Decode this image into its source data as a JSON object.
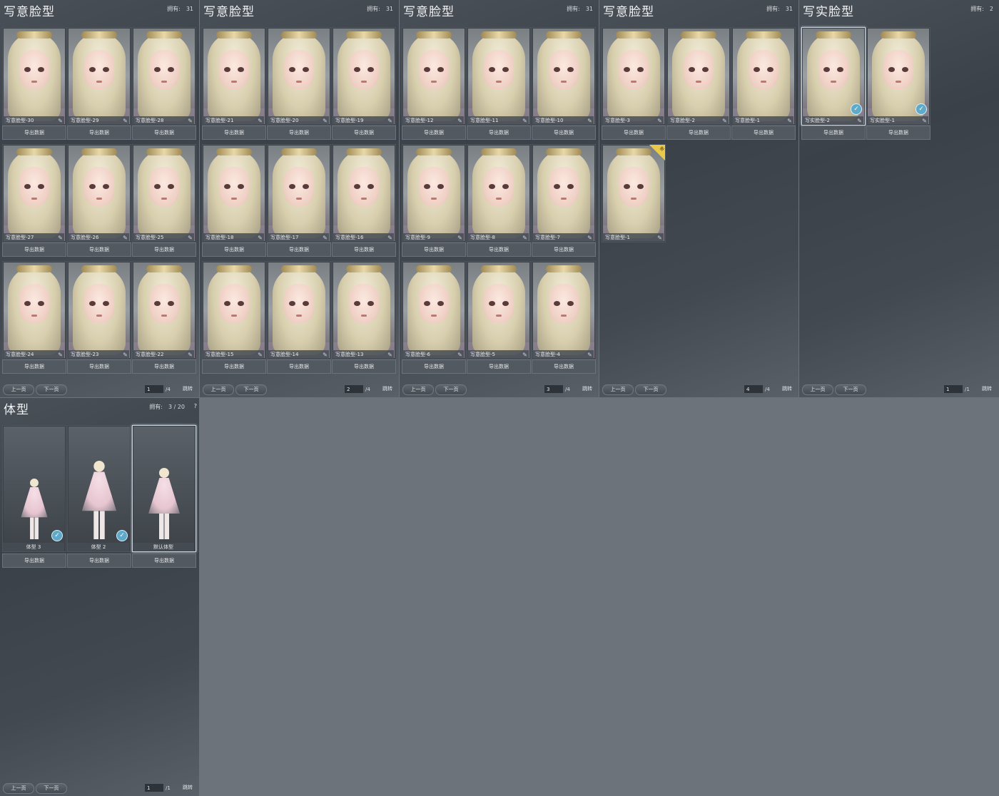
{
  "common": {
    "export_label": "导出数据",
    "prev_label": "上一页",
    "next_label": "下一页",
    "jump_label": "跳转",
    "owned_label": "拥有:"
  },
  "panels": [
    {
      "title": "写意脸型",
      "owned": "31",
      "page": "1",
      "total": "/4",
      "cards": [
        "写意脸型-30",
        "写意脸型-29",
        "写意脸型-28",
        "写意脸型-27",
        "写意脸型-26",
        "写意脸型-25",
        "写意脸型-24",
        "写意脸型-23",
        "写意脸型-22"
      ]
    },
    {
      "title": "写意脸型",
      "owned": "31",
      "page": "2",
      "total": "/4",
      "cards": [
        "写意脸型-21",
        "写意脸型-20",
        "写意脸型-19",
        "写意脸型-18",
        "写意脸型-17",
        "写意脸型-16",
        "写意脸型-15",
        "写意脸型-14",
        "写意脸型-13"
      ]
    },
    {
      "title": "写意脸型",
      "owned": "31",
      "page": "3",
      "total": "/4",
      "cards": [
        "写意脸型-12",
        "写意脸型-11",
        "写意脸型-10",
        "写意脸型-9",
        "写意脸型-8",
        "写意脸型-7",
        "写意脸型-6",
        "写意脸型-5",
        "写意脸型-4"
      ]
    },
    {
      "title": "写意脸型",
      "owned": "31",
      "page": "4",
      "total": "/4",
      "cards": [
        "写意脸型-3",
        "写意脸型-2",
        "写意脸型-1",
        "写意脸型-1"
      ]
    },
    {
      "title": "写实脸型",
      "owned": "2",
      "page": "1",
      "total": "/1",
      "cards": [
        "写实脸型-2",
        "写实脸型-1"
      ]
    }
  ],
  "body_panel": {
    "title": "体型",
    "owned": "3 / 20",
    "page": "1",
    "total": "/1",
    "help": "?",
    "cards": [
      "体型 3",
      "体型 2",
      "默认体型"
    ]
  },
  "new_badge": "新"
}
